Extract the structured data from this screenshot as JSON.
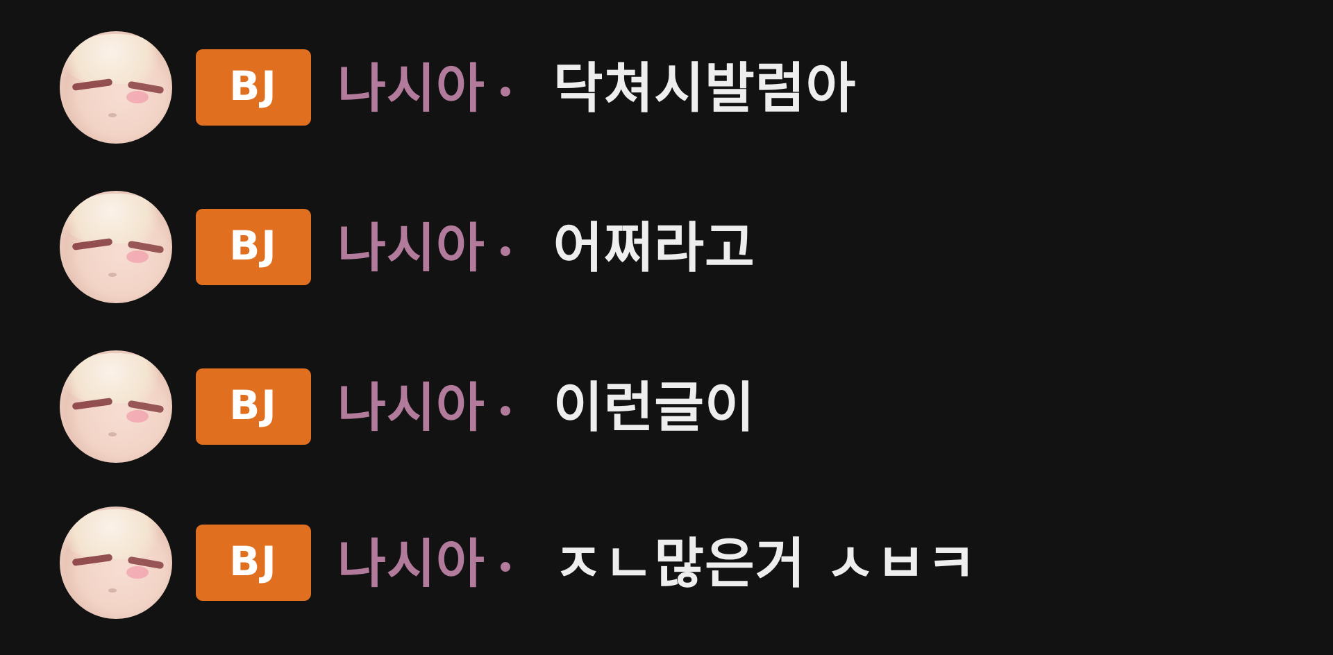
{
  "chat": {
    "messages": [
      {
        "badge": "BJ",
        "username": "나시아",
        "text": "닥쳐시발럼아"
      },
      {
        "badge": "BJ",
        "username": "나시아",
        "text": "어쩌라고"
      },
      {
        "badge": "BJ",
        "username": "나시아",
        "text": "이런글이"
      },
      {
        "badge": "BJ",
        "username": "나시아",
        "text": "ㅈㄴ많은거 ㅅㅂㅋ"
      }
    ]
  },
  "colors": {
    "background": "#121212",
    "badge_bg": "#e06f1f",
    "username": "#b27a9b",
    "message_text": "#eeeeee"
  },
  "icons": {
    "avatar": "user-avatar",
    "badge": "bj-badge"
  }
}
